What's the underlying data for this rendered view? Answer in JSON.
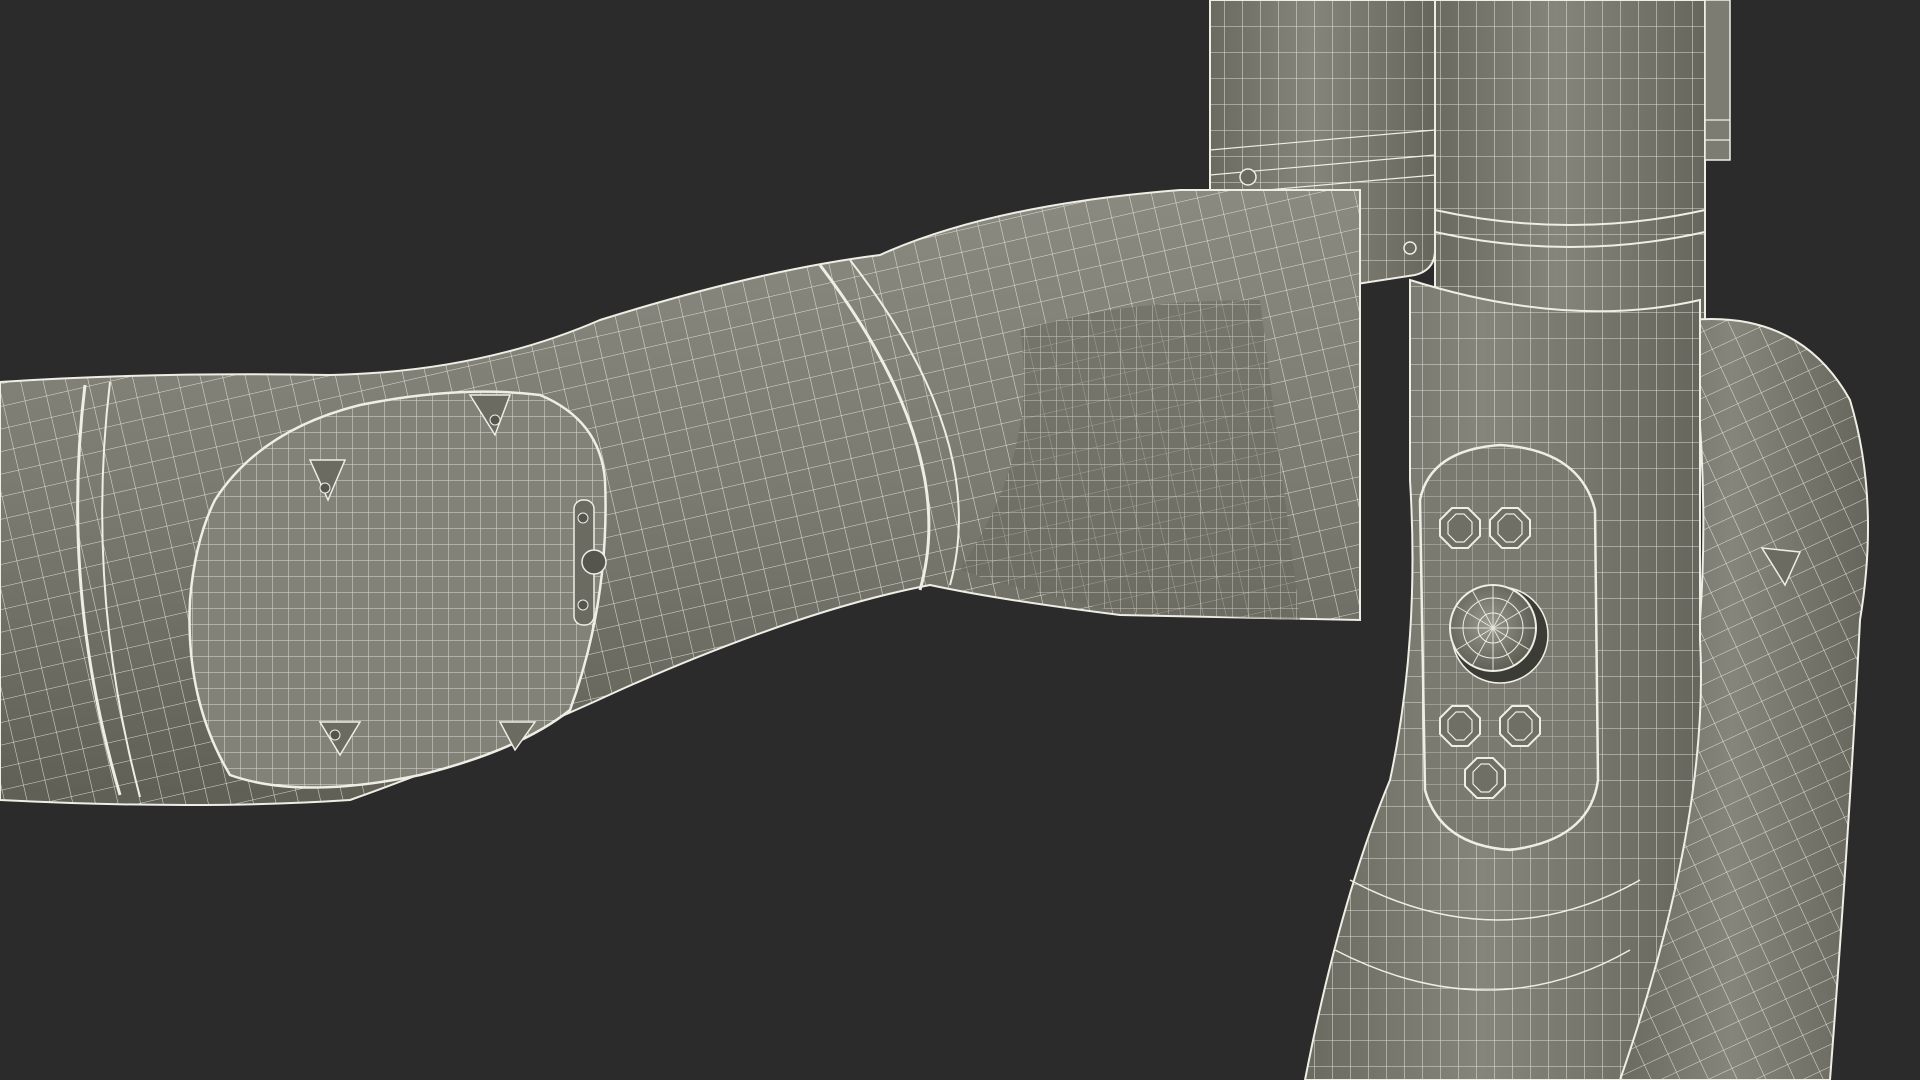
{
  "scene": {
    "background_color": "#2b2b2b",
    "model_color": "#7b7b70",
    "wire_color": "#efeee4",
    "shade_color": "#5e5e55",
    "highlight_color": "#8e8e84"
  }
}
